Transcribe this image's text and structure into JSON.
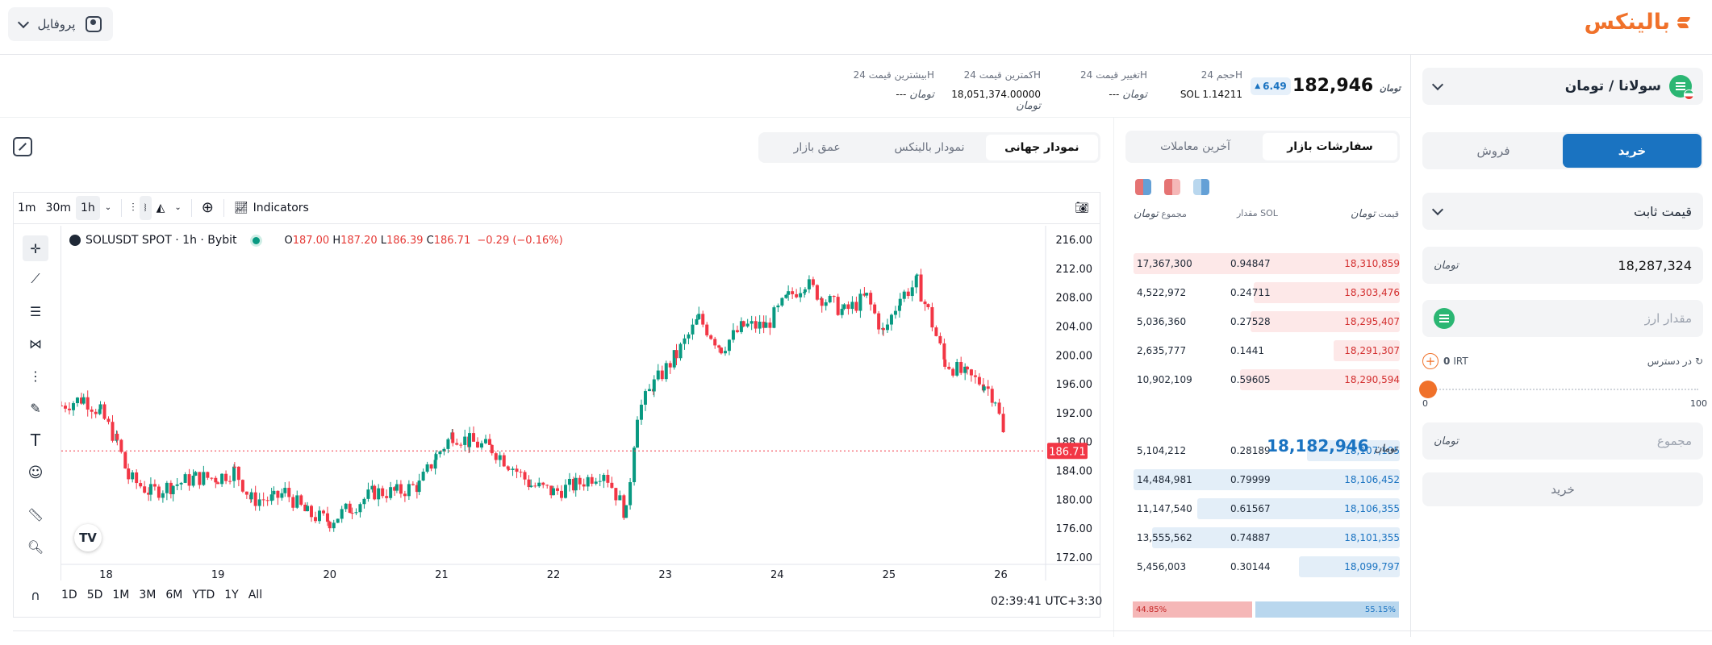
{
  "header": {
    "profile_label": "پروفایل",
    "logo_text": "بالینکس"
  },
  "form": {
    "pair": "سولانا / تومان",
    "tabs": {
      "buy": "خرید",
      "sell": "فروش"
    },
    "order_type": "قیمت ثابت",
    "price_value": "18,287,324",
    "currency_label": "تومان",
    "amount_placeholder": "مقدار ارز",
    "available_label": "در دسترس",
    "available_value": "0",
    "available_unit": "IRT",
    "slider_min": "0",
    "slider_max": "100",
    "slider_value": 0,
    "total_placeholder": "مجموع",
    "submit_label": "خرید"
  },
  "stats": {
    "last_price": "18,182,946",
    "change": "6.49",
    "volume_label": "حجم 24H",
    "volume_value": "SOL 1.14211",
    "change24_label": "تغییر قیمت 24H",
    "change24_value": "---",
    "low_label": "کمترین قیمت 24H",
    "low_value": "18,051,374.00000",
    "high_label": "بیشترین قیمت 24H",
    "high_value": "---"
  },
  "orderbook": {
    "tabs": {
      "orders": "سفارشات بازار",
      "trades": "آخرین معاملات"
    },
    "headers": {
      "price": "قیمت",
      "amount": "مقدار SOL",
      "total": "مجموع"
    },
    "asks": [
      {
        "price": "18,310,859",
        "amount": "0.94847",
        "total": "17,367,300",
        "depth": 1.0
      },
      {
        "price": "18,303,476",
        "amount": "0.24711",
        "total": "4,522,972",
        "depth": 0.55
      },
      {
        "price": "18,295,407",
        "amount": "0.27528",
        "total": "5,036,360",
        "depth": 0.56
      },
      {
        "price": "18,291,307",
        "amount": "0.1441",
        "total": "2,635,777",
        "depth": 0.25
      },
      {
        "price": "18,290,594",
        "amount": "0.59605",
        "total": "10,902,109",
        "depth": 0.6
      }
    ],
    "mid_price": "18,182,946",
    "bids": [
      {
        "price": "18,107,105",
        "amount": "0.28189",
        "total": "5,104,212",
        "depth": 0.35
      },
      {
        "price": "18,106,452",
        "amount": "0.79999",
        "total": "14,484,981",
        "depth": 1.0
      },
      {
        "price": "18,106,355",
        "amount": "0.61567",
        "total": "11,147,540",
        "depth": 0.76
      },
      {
        "price": "18,101,355",
        "amount": "0.74887",
        "total": "13,555,562",
        "depth": 0.93
      },
      {
        "price": "18,099,797",
        "amount": "0.30144",
        "total": "5,456,003",
        "depth": 0.38
      }
    ],
    "sell_pct": "44.85%",
    "buy_pct": "55.15%",
    "sell_ratio": 44.85
  },
  "chart_tabs": [
    "نمودار جهانی",
    "نمودار بالینکس",
    "عمق بازار"
  ],
  "chart_toolbar": {
    "intervals": [
      "1m",
      "30m",
      "1h"
    ],
    "indicators_label": "Indicators"
  },
  "chart_data": {
    "type": "candlestick",
    "symbol": "SOLUSDT SPOT · 1h · Bybit",
    "ohlc": {
      "o": "187.00",
      "h": "187.20",
      "l": "186.39",
      "c": "186.71",
      "chg": "−0.29 (−0.16%)"
    },
    "last_price_label": "186.71",
    "last_price": 186.71,
    "ylim": [
      171,
      217
    ],
    "y_ticks": [
      "216.00",
      "212.00",
      "208.00",
      "204.00",
      "200.00",
      "196.00",
      "192.00",
      "188.00",
      "184.00",
      "180.00",
      "176.00",
      "172.00"
    ],
    "x_ticks": [
      "18",
      "19",
      "20",
      "21",
      "22",
      "23",
      "24",
      "25",
      "26"
    ],
    "path_points": [
      [
        17.6,
        193
      ],
      [
        17.8,
        194
      ],
      [
        17.95,
        192
      ],
      [
        18.1,
        188
      ],
      [
        18.2,
        183
      ],
      [
        18.4,
        181
      ],
      [
        18.6,
        182
      ],
      [
        18.8,
        183
      ],
      [
        19.0,
        183
      ],
      [
        19.15,
        184
      ],
      [
        19.3,
        180
      ],
      [
        19.5,
        180
      ],
      [
        19.6,
        181
      ],
      [
        19.8,
        178
      ],
      [
        20.0,
        177
      ],
      [
        20.2,
        179
      ],
      [
        20.4,
        181
      ],
      [
        20.6,
        181
      ],
      [
        20.8,
        182
      ],
      [
        20.95,
        186
      ],
      [
        21.1,
        189
      ],
      [
        21.25,
        188
      ],
      [
        21.45,
        187
      ],
      [
        21.6,
        185
      ],
      [
        21.8,
        182
      ],
      [
        22.0,
        181
      ],
      [
        22.2,
        182
      ],
      [
        22.45,
        184
      ],
      [
        22.65,
        178
      ],
      [
        22.75,
        192
      ],
      [
        22.9,
        196
      ],
      [
        23.1,
        200
      ],
      [
        23.3,
        205
      ],
      [
        23.5,
        201
      ],
      [
        23.7,
        204
      ],
      [
        23.9,
        204
      ],
      [
        24.1,
        208
      ],
      [
        24.25,
        210
      ],
      [
        24.4,
        208
      ],
      [
        24.6,
        206
      ],
      [
        24.8,
        208
      ],
      [
        24.95,
        203
      ],
      [
        25.1,
        208
      ],
      [
        25.25,
        210
      ],
      [
        25.35,
        206
      ],
      [
        25.5,
        199
      ],
      [
        25.7,
        197
      ],
      [
        25.85,
        196
      ],
      [
        25.95,
        194
      ],
      [
        26.05,
        187
      ]
    ],
    "ranges": [
      "1D",
      "5D",
      "1M",
      "3M",
      "6M",
      "YTD",
      "1Y",
      "All"
    ],
    "time": "02:39:41 UTC+3:30"
  },
  "colors": {
    "accent": "#1a73c1",
    "brand": "#f0712a",
    "up": "#089981",
    "down": "#f23645"
  }
}
